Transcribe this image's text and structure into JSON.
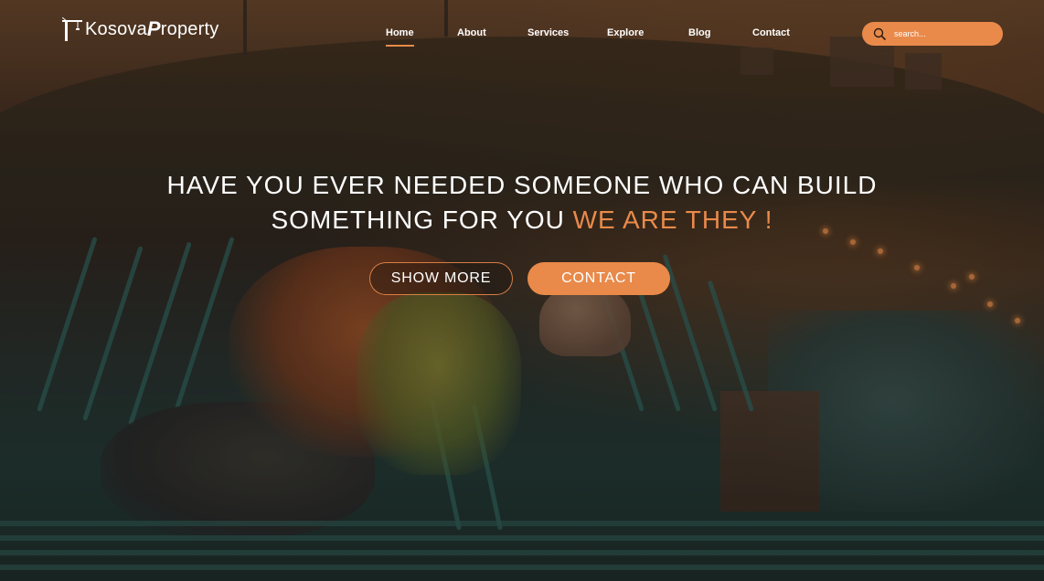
{
  "brand": {
    "logo_text_regular": "Kosova",
    "logo_text_bold": "P",
    "logo_text_rest": "roperty",
    "accent_color": "#e98a4a"
  },
  "nav": {
    "items": [
      {
        "label": "Home",
        "active": true
      },
      {
        "label": "About",
        "active": false
      },
      {
        "label": "Services",
        "active": false
      },
      {
        "label": "Explore",
        "active": false
      },
      {
        "label": "Blog",
        "active": false
      },
      {
        "label": "Contact",
        "active": false
      }
    ]
  },
  "search": {
    "placeholder": "search...",
    "icon": "search-icon"
  },
  "hero": {
    "line1": "HAVE YOU EVER NEEDED SOMEONE WHO CAN BUILD",
    "line2_plain": "SOMETHING FOR YOU ",
    "line2_accent": "WE ARE THEY !",
    "primary_button": "SHOW MORE",
    "secondary_button": "CONTACT"
  }
}
